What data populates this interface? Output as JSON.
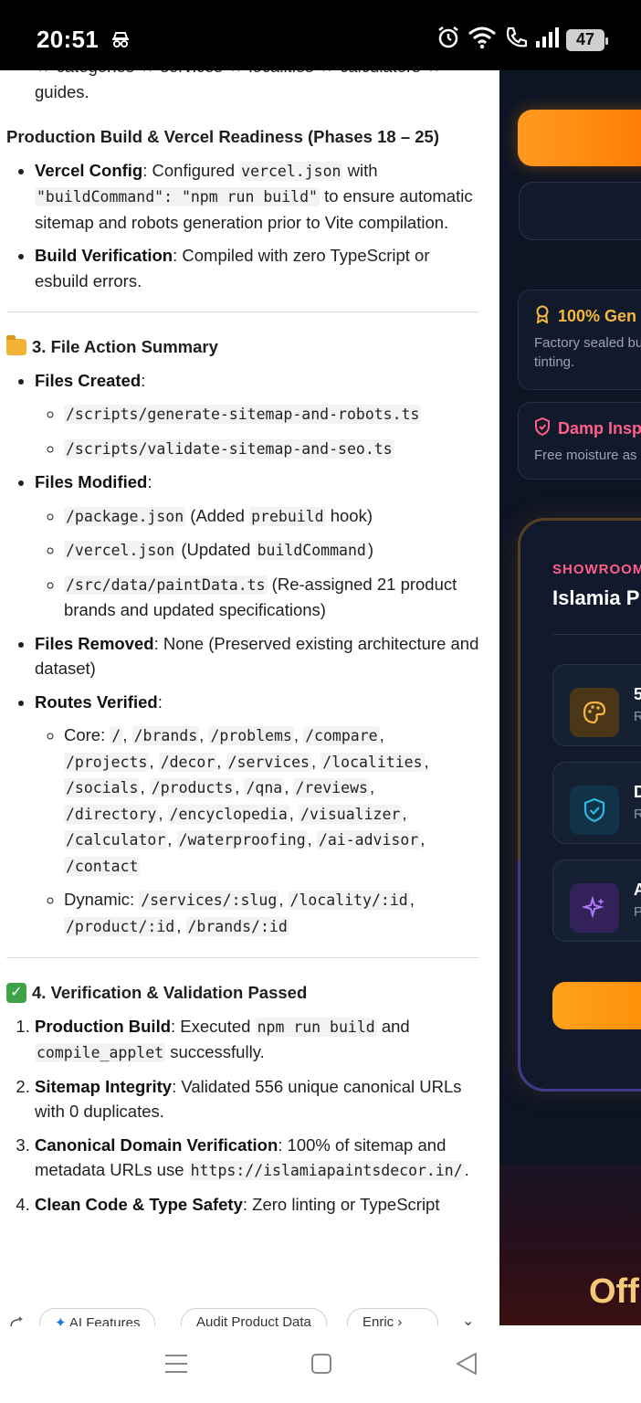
{
  "status_bar": {
    "time": "20:51",
    "battery": "47"
  },
  "doc": {
    "cont_text": "↔ categories ↔ services ↔ localities ↔ calculators ↔ guides.",
    "production_heading": "Production Build & Vercel Readiness (Phases 18 – 25)",
    "vercel": {
      "label": "Vercel Config",
      "t1": ": Configured ",
      "c1": "vercel.json",
      "t2": " with ",
      "c2": "\"buildCommand\": \"npm run build\"",
      "t3": " to ensure automatic sitemap and robots generation prior to Vite compilation."
    },
    "build": {
      "label": "Build Verification",
      "text": ": Compiled with zero TypeScript or esbuild errors."
    },
    "section3_title": "3. File Action Summary",
    "files_created": {
      "label": "Files Created",
      "colon": ":",
      "items": [
        "/scripts/generate-sitemap-and-robots.ts",
        "/scripts/validate-sitemap-and-seo.ts"
      ]
    },
    "files_modified": {
      "label": "Files Modified",
      "colon": ":",
      "item1_code": "/package.json",
      "item1_t1": " (Added ",
      "item1_code2": "prebuild",
      "item1_t2": " hook)",
      "item2_code": "/vercel.json",
      "item2_t1": " (Updated ",
      "item2_code2": "buildCommand",
      "item2_t2": ")",
      "item3_code": "/src/data/paintData.ts",
      "item3_text": " (Re-assigned 21 product brands and updated specifications)"
    },
    "files_removed": {
      "label": "Files Removed",
      "text": ": None (Preserved existing architecture and dataset)"
    },
    "routes": {
      "label": "Routes Verified",
      "colon": ":",
      "core_label": "Core: ",
      "core_routes": [
        "/",
        "/brands",
        "/problems",
        "/compare",
        "/projects",
        "/decor",
        "/services",
        "/localities",
        "/socials",
        "/products",
        "/qna",
        "/reviews",
        "/directory",
        "/encyclopedia",
        "/visualizer",
        "/calculator",
        "/waterproofing",
        "/ai-advisor",
        "/contact"
      ],
      "dynamic_label": "Dynamic: ",
      "dynamic_routes": [
        "/services/:slug",
        "/locality/:id",
        "/product/:id",
        "/brands/:id"
      ]
    },
    "section4_title": "4. Verification & Validation Passed",
    "verify": {
      "i1_label": "Production Build",
      "i1_t1": ": Executed ",
      "i1_c1": "npm run build",
      "i1_t2": " and ",
      "i1_c2": "compile_applet",
      "i1_t3": " successfully.",
      "i2_label": "Sitemap Integrity",
      "i2_text": ": Validated 556 unique canonical URLs with 0 duplicates.",
      "i3_label": "Canonical Domain Verification",
      "i3_text": ": 100% of sitemap and metadata URLs use ",
      "i3_code": "https://islamiapaintsdecor.in/",
      "i3_end": ".",
      "i4_label": "Clean Code & Type Safety",
      "i4_text": ": Zero linting or TypeScript"
    }
  },
  "chips": [
    "AI Features",
    "Audit Product Data",
    "Enric"
  ],
  "preview": {
    "feature1_title": "100% Gen",
    "feature1_desc_l1": "Factory sealed bu",
    "feature1_desc_l2": "tinting.",
    "feature2_title": "Damp Insp",
    "feature2_desc": "Free moisture as",
    "card_tag": "SHOWROOM",
    "card_title": "Islamia P",
    "mini1_l1": "5",
    "mini1_l2": "R",
    "mini2_l1": "D",
    "mini2_l2": "R",
    "mini3_l1": "A",
    "mini3_l2": "P",
    "bottom_text": "Off",
    "colors": {
      "orange": "#ff8a00",
      "gold": "#f5b83d",
      "pink": "#ff5f86",
      "bg": "#0d1424"
    }
  }
}
